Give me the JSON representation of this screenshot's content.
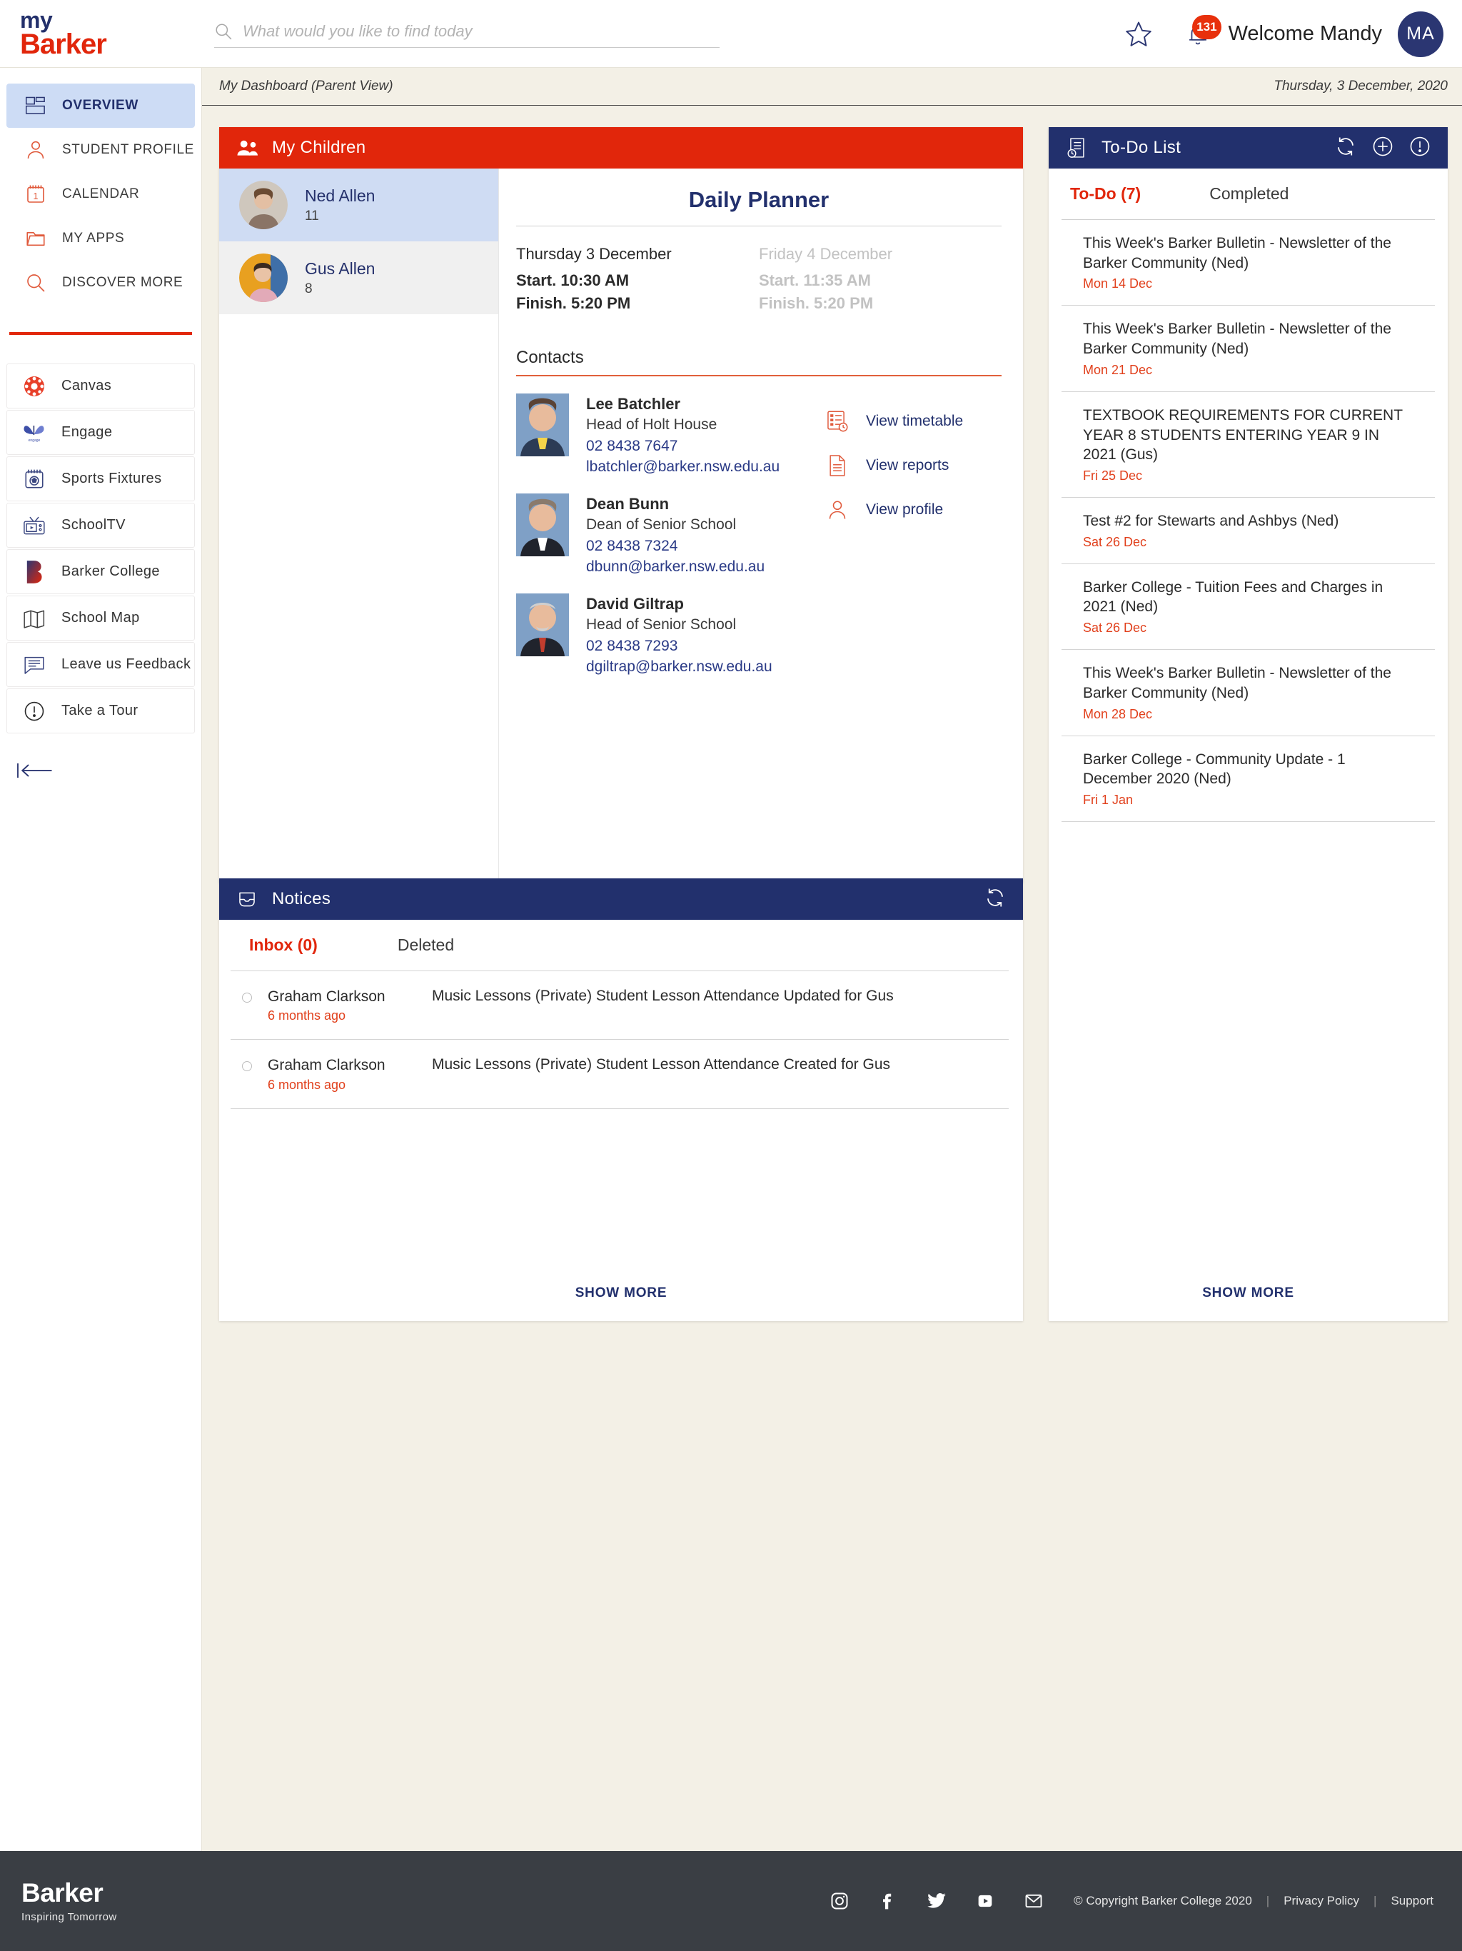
{
  "header": {
    "logo_line1": "my",
    "logo_line2": "Barker",
    "search_placeholder": "What would you like to find today",
    "search_value": "",
    "notification_count": "131",
    "welcome_text": "Welcome Mandy",
    "avatar_initials": "MA"
  },
  "sidebar": {
    "nav": [
      {
        "label": "OVERVIEW",
        "icon": "dashboard-icon",
        "active": true
      },
      {
        "label": "STUDENT PROFILE",
        "icon": "person-icon",
        "active": false
      },
      {
        "label": "CALENDAR",
        "icon": "calendar-icon",
        "active": false
      },
      {
        "label": "MY APPS",
        "icon": "folder-icon",
        "active": false
      },
      {
        "label": "DISCOVER MORE",
        "icon": "search-icon",
        "active": false
      }
    ],
    "apps": [
      {
        "label": "Canvas",
        "icon": "canvas-icon"
      },
      {
        "label": "Engage",
        "icon": "engage-butterfly-icon"
      },
      {
        "label": "Sports Fixtures",
        "icon": "sports-calendar-icon"
      },
      {
        "label": "SchoolTV",
        "icon": "tv-icon"
      },
      {
        "label": "Barker College",
        "icon": "barker-b-icon"
      },
      {
        "label": "School Map",
        "icon": "map-icon"
      },
      {
        "label": "Leave us Feedback",
        "icon": "feedback-icon"
      },
      {
        "label": "Take a Tour",
        "icon": "info-icon"
      }
    ],
    "collapse_icon": "collapse-sidebar-icon"
  },
  "breadcrumb": {
    "left": "My Dashboard (Parent View)",
    "right": "Thursday, 3 December, 2020"
  },
  "children_panel": {
    "title": "My Children",
    "icon": "people-icon",
    "children": [
      {
        "name": "Ned Allen",
        "year": "11",
        "selected": true
      },
      {
        "name": "Gus Allen",
        "year": "8",
        "selected": false
      }
    ]
  },
  "planner": {
    "title": "Daily Planner",
    "days": [
      {
        "title": "Thursday 3 December",
        "start": "Start. 10:30 AM",
        "finish": "Finish. 5:20 PM",
        "dim": false
      },
      {
        "title": "Friday 4 December",
        "start": "Start. 11:35 AM",
        "finish": "Finish. 5:20 PM",
        "dim": true
      }
    ]
  },
  "contacts": {
    "heading": "Contacts",
    "people": [
      {
        "name": "Lee Batchler",
        "role": "Head of Holt House",
        "phone": "02 8438 7647",
        "email": "lbatchler@barker.nsw.edu.au"
      },
      {
        "name": "Dean Bunn",
        "role": "Dean of Senior School",
        "phone": "02 8438 7324",
        "email": "dbunn@barker.nsw.edu.au"
      },
      {
        "name": "David Giltrap",
        "role": "Head of Senior School",
        "phone": "02 8438 7293",
        "email": "dgiltrap@barker.nsw.edu.au"
      }
    ],
    "quick_links": [
      {
        "label": "View timetable",
        "icon": "timetable-icon"
      },
      {
        "label": "View reports",
        "icon": "report-document-icon"
      },
      {
        "label": "View profile",
        "icon": "profile-person-icon"
      }
    ]
  },
  "todo_panel": {
    "title": "To-Do List",
    "icon": "todo-list-icon",
    "actions": [
      {
        "icon": "refresh-icon"
      },
      {
        "icon": "add-circle-icon"
      },
      {
        "icon": "info-circle-icon"
      }
    ],
    "tabs": [
      {
        "label": "To-Do (7)",
        "active": true
      },
      {
        "label": "Completed",
        "active": false
      }
    ],
    "items": [
      {
        "title": "This Week's Barker Bulletin - Newsletter of the Barker Community (Ned)",
        "date": "Mon 14 Dec"
      },
      {
        "title": "This Week's Barker Bulletin - Newsletter of the Barker Community (Ned)",
        "date": "Mon 21 Dec"
      },
      {
        "title": "TEXTBOOK REQUIREMENTS FOR CURRENT YEAR 8 STUDENTS ENTERING YEAR 9 IN 2021 (Gus)",
        "date": "Fri 25 Dec"
      },
      {
        "title": "Test #2 for Stewarts and Ashbys (Ned)",
        "date": "Sat 26 Dec"
      },
      {
        "title": "Barker College - Tuition Fees and Charges in 2021 (Ned)",
        "date": "Sat 26 Dec"
      },
      {
        "title": "This Week's Barker Bulletin - Newsletter of the Barker Community (Ned)",
        "date": "Mon 28 Dec"
      },
      {
        "title": "Barker College - Community Update - 1 December 2020 (Ned)",
        "date": "Fri 1 Jan"
      }
    ],
    "show_more": "SHOW MORE"
  },
  "notices_panel": {
    "title": "Notices",
    "icon": "inbox-icon",
    "refresh_icon": "refresh-icon",
    "tabs": [
      {
        "label": "Inbox (0)",
        "active": true
      },
      {
        "label": "Deleted",
        "active": false
      }
    ],
    "rows": [
      {
        "sender": "Graham Clarkson",
        "ago": "6 months ago",
        "subject": "Music Lessons (Private) Student Lesson Attendance Updated for Gus"
      },
      {
        "sender": "Graham Clarkson",
        "ago": "6 months ago",
        "subject": "Music Lessons (Private) Student Lesson Attendance Created for Gus"
      }
    ],
    "show_more": "SHOW MORE"
  },
  "footer": {
    "logo": "Barker",
    "tagline": "Inspiring Tomorrow",
    "social": [
      "instagram-icon",
      "facebook-icon",
      "twitter-icon",
      "youtube-icon",
      "email-icon"
    ],
    "copyright": "© Copyright Barker College 2020",
    "privacy": "Privacy Policy",
    "support": "Support"
  },
  "colors": {
    "brand_red": "#e1260b",
    "brand_navy": "#22306d",
    "page_bg": "#f3f0e6",
    "footer_bg": "#3a3e44",
    "selected_row": "#cfdcf3"
  }
}
